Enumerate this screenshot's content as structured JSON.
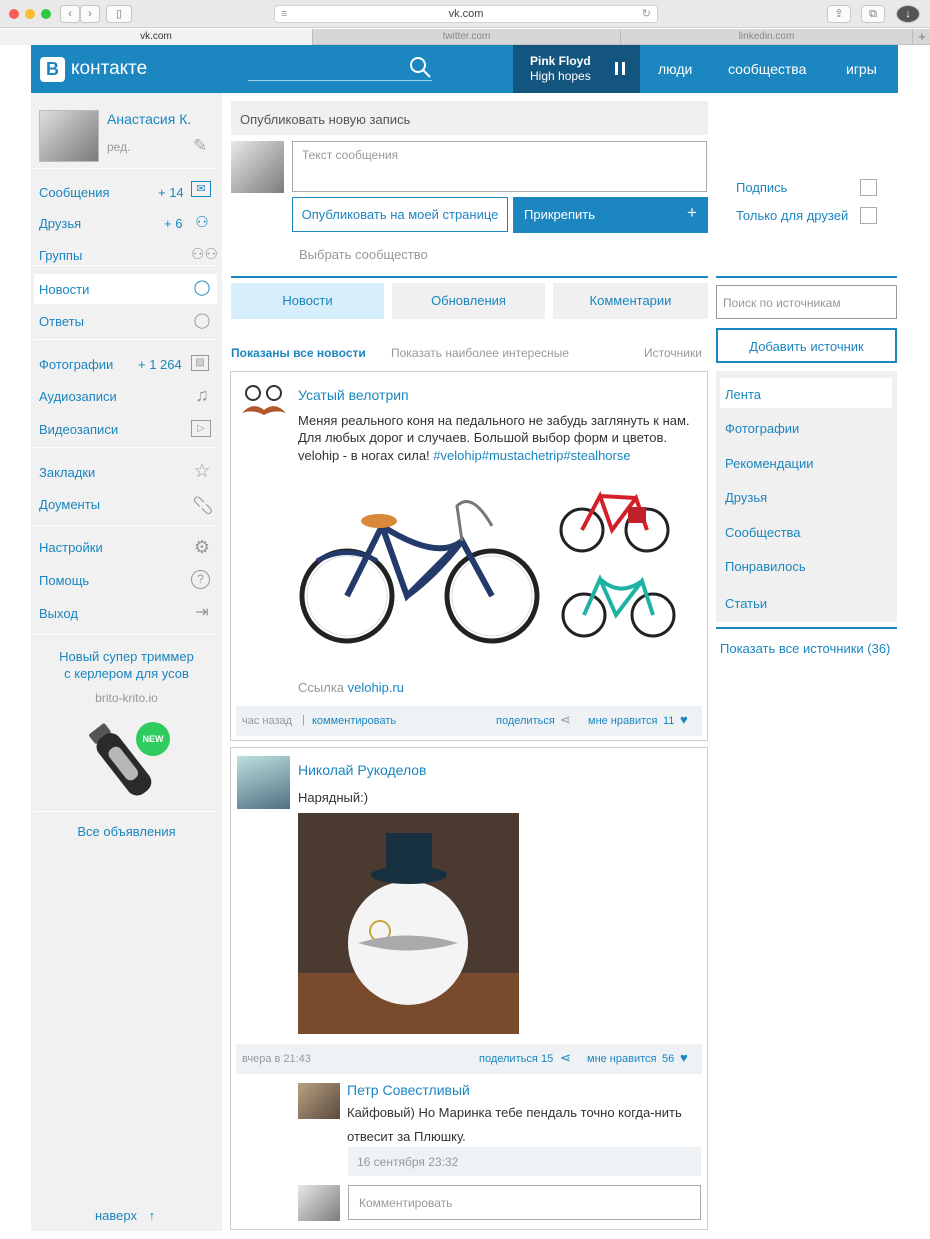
{
  "browser": {
    "url": "vk.com",
    "tabs": [
      "vk.com",
      "twitter.com",
      "linkedin.com"
    ]
  },
  "header": {
    "logo_letter": "В",
    "logo_text": "контакте",
    "player": {
      "artist": "Pink Floyd",
      "track": "High hopes"
    },
    "nav": [
      "люди",
      "сообщества",
      "игры"
    ]
  },
  "profile": {
    "name": "Анастасия К.",
    "edit": "ред."
  },
  "sidebar": {
    "items": [
      {
        "label": "Сообщения",
        "count": "+ 14",
        "icon": "envelope-icon"
      },
      {
        "label": "Друзья",
        "count": "+ 6",
        "icon": "person-icon"
      },
      {
        "label": "Группы",
        "count": "",
        "icon": "group-icon"
      },
      {
        "label": "Новости",
        "count": "",
        "icon": "speech-bubble-icon"
      },
      {
        "label": "Ответы",
        "count": "",
        "icon": "chat-icon"
      },
      {
        "label": "Фотографии",
        "count": "+ 1 264",
        "icon": "photo-icon"
      },
      {
        "label": "Аудиозаписи",
        "count": "",
        "icon": "music-note-icon"
      },
      {
        "label": "Видеозаписи",
        "count": "",
        "icon": "video-icon"
      },
      {
        "label": "Закладки",
        "count": "",
        "icon": "star-icon"
      },
      {
        "label": "Доументы",
        "count": "",
        "icon": "paperclip-icon"
      },
      {
        "label": "Настройки",
        "count": "",
        "icon": "gear-icon"
      },
      {
        "label": "Помощь",
        "count": "",
        "icon": "help-icon"
      },
      {
        "label": "Выход",
        "count": "",
        "icon": "logout-icon"
      }
    ],
    "ad": {
      "title_line1": "Новый супер триммер",
      "title_line2": "с керлером для усов",
      "site": "brito-krito.io",
      "badge": "NEW"
    },
    "all_ads": "Все объявления",
    "to_top": "наверх",
    "to_top_arrow": "↑"
  },
  "composer": {
    "header": "Опубликовать новую запись",
    "placeholder": "Текст сообщения",
    "publish": "Опубликовать на моей странице",
    "attach": "Прикрепить",
    "attach_plus": "+",
    "community": "Выбрать сообщество",
    "options": [
      "Подпись",
      "Только для друзей"
    ]
  },
  "feed_tabs": [
    "Новости",
    "Обновления",
    "Комментарии"
  ],
  "filters": {
    "all": "Показаны все новости",
    "interesting": "Показать наиболее интересные",
    "sources": "Источники"
  },
  "right": {
    "search_placeholder": "Поиск по источникам",
    "add_source": "Добавить источник",
    "nav": [
      "Лента",
      "Фотографии",
      "Рекомендации",
      "Друзья",
      "Сообщества",
      "Понравилось",
      "Статьи"
    ],
    "all_sources": "Показать все источники (36)"
  },
  "posts": [
    {
      "author": "Усатый велотрип",
      "text_line1": "Меняя реального коня на педального не забудь заглянуть к нам.",
      "text_line2": "Для любых дорог и случаев. Большой выбор форм и цветов.",
      "text_line3": "velohip - в ногах сила!",
      "hashtags": "#velohip#mustachetrip#stealhorse",
      "link_label": "Ссылка",
      "link": "velohip.ru",
      "time": "час назад",
      "sep": "|",
      "comment": "комментировать",
      "share": "поделиться",
      "like": "мне нравится",
      "like_count": "11"
    },
    {
      "author": "Николай Рукоделов",
      "text": "Нарядный:)",
      "time": "вчера в 21:43",
      "share": "поделиться",
      "share_count": "15",
      "like": "мне нравится",
      "like_count": "56",
      "reply": {
        "author": "Петр Совестливый",
        "text_line1": "Кайфовый) Но Маринка тебе пендаль точно когда-нить",
        "text_line2": "отвесит за Плюшку.",
        "time": "16 сентября 23:32"
      },
      "comment_placeholder": "Комментировать"
    }
  ],
  "colors": {
    "brand": "#1c86c1",
    "player": "#13557e",
    "tab_active": "#d6effa",
    "sidebar": "#f1f1f1",
    "badge": "#2ecc5f"
  }
}
